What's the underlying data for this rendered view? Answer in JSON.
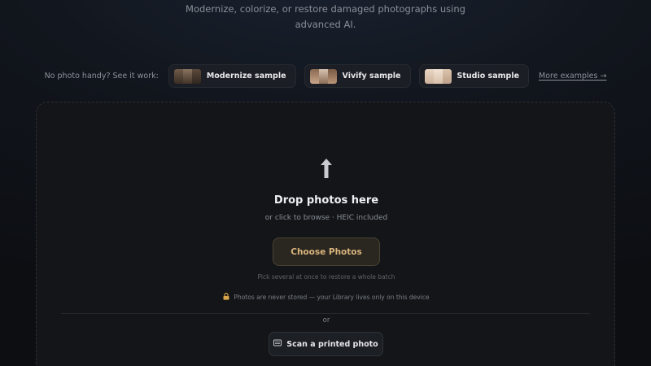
{
  "hero": {
    "subtitle_line1": "Modernize, colorize, or restore damaged photographs using",
    "subtitle_line2": "advanced AI."
  },
  "samples": {
    "lead": "No photo handy? See it work:",
    "items": [
      {
        "label": "Modernize sample",
        "icon": "thumbnail-modernize-icon"
      },
      {
        "label": "Vivify sample",
        "icon": "thumbnail-vivify-icon"
      },
      {
        "label": "Studio sample",
        "icon": "thumbnail-studio-icon"
      }
    ],
    "more_link": "More examples →"
  },
  "dropzone": {
    "icon": "upload-arrow-icon",
    "title": "Drop photos here",
    "subtitle": "or click to browse · HEIC included",
    "choose_button": "Choose Photos",
    "hint": "Pick several at once to restore a whole batch",
    "privacy_icon": "lock-icon",
    "privacy": "Photos are never stored — your Library lives only on this device",
    "or": "or",
    "scan_icon": "scanner-icon",
    "scan_button": "Scan a printed photo"
  },
  "colors": {
    "accent": "#d8b47c",
    "background": "#0c0e12",
    "panel": "#131518"
  }
}
